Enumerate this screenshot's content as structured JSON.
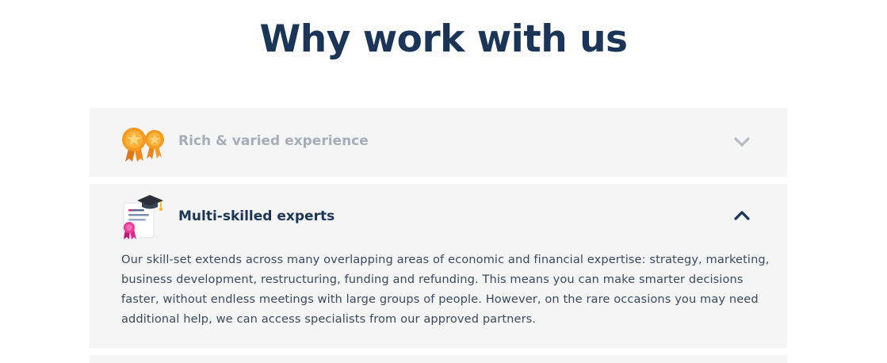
{
  "section": {
    "title": "Why work with us"
  },
  "accordion": {
    "items": [
      {
        "title": "Rich & varied experience",
        "icon": "medals-icon",
        "state": "collapsed",
        "chevron": "chevron-down-icon"
      },
      {
        "title": "Multi-skilled experts",
        "icon": "diploma-certificate-icon",
        "state": "expanded",
        "chevron": "chevron-up-icon",
        "body": "Our skill-set extends across many overlapping areas of economic and financial expertise: strategy, marketing, business development, restructuring, funding and refunding. This means you can make smarter decisions faster, without endless meetings with large groups of people. However, on the rare occasions you may need additional help, we can access specialists from our approved partners."
      }
    ]
  },
  "colors": {
    "heading": "#1b3558",
    "muted_title": "#a6adb8",
    "body_text": "#3b4a5e",
    "panel_bg": "#f5f5f6",
    "medal_orange": "#f7a226",
    "ribbon_pink": "#e2268a"
  }
}
